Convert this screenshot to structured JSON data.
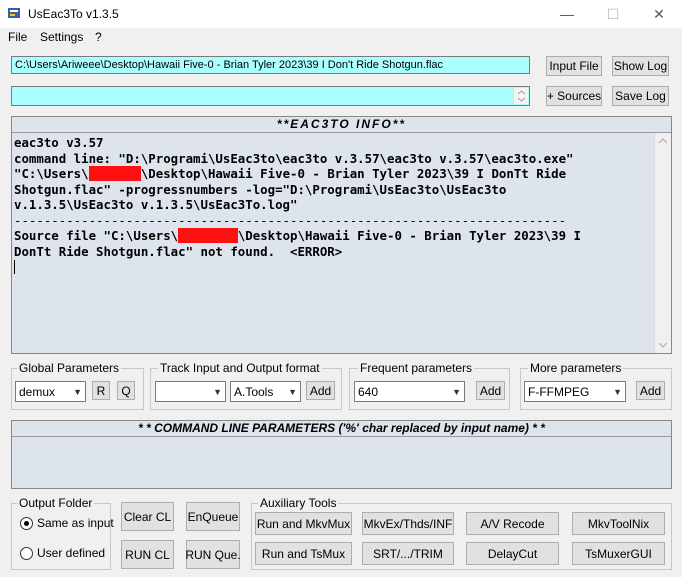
{
  "window": {
    "title": "UsEac3To v1.3.5",
    "minimize": "—",
    "maximize": "☐",
    "close": "✕"
  },
  "menu": {
    "file": "File",
    "settings": "Settings",
    "help": "?"
  },
  "top": {
    "input_path": "C:\\Users\\Ariweee\\Desktop\\Hawaii Five-0 - Brian Tyler 2023\\39 I Don't Ride Shotgun.flac",
    "sources_value": "",
    "input_file_btn": "Input File",
    "show_log_btn": "Show Log",
    "sources_btn": "+ Sources",
    "save_log_btn": "Save Log"
  },
  "info": {
    "header": "**EAC3TO INFO**",
    "line1": "eac3to v3.57",
    "line2": "command line: \"D:\\Programi\\UsEac3to\\eac3to v.3.57\\eac3to v.3.57\\eac3to.exe\"",
    "line3a": "\"C:\\Users\\",
    "line3_redacted": "XXXXXXX",
    "line3b": "\\Desktop\\Hawaii Five-0 - Brian Tyler 2023\\39 I DonTt Ride",
    "line4": "Shotgun.flac\" -progressnumbers -log=\"D:\\Programi\\UsEac3to\\UsEac3to",
    "line5": "v.1.3.5\\UsEac3to v.1.3.5\\UsEac3To.log\"",
    "separator": "--------------------------------------------------------------------------",
    "line6a": "Source file \"C:\\Users\\",
    "line6_redacted": "XXXXXXXX",
    "line6b": "\\Desktop\\Hawaii Five-0 - Brian Tyler 2023\\39 I",
    "line7": "DonTt Ride Shotgun.flac\" not found.  <ERROR>"
  },
  "global_params": {
    "label": "Global Parameters",
    "combo_value": "demux",
    "r_btn": "R",
    "q_btn": "Q"
  },
  "track": {
    "label": "Track Input and Output format",
    "combo1_value": "",
    "combo2_value": "A.Tools",
    "add_btn": "Add"
  },
  "frequent": {
    "label": "Frequent parameters",
    "combo_value": "640",
    "add_btn": "Add"
  },
  "more": {
    "label": "More parameters",
    "combo_value": "F-FFMPEG",
    "add_btn": "Add"
  },
  "cmd": {
    "header": "* * COMMAND LINE PARAMETERS ('%' char replaced by input name) * *",
    "value": ""
  },
  "output_folder": {
    "label": "Output Folder",
    "same_as_input": "Same as input",
    "user_defined": "User defined",
    "selected": "same_as_input"
  },
  "actions": {
    "clear_cl": "Clear CL",
    "enqueue": "EnQueue",
    "run_cl": "RUN CL",
    "run_que": "RUN Que."
  },
  "aux": {
    "label": "Auxiliary Tools",
    "run_mkvmux": "Run and MkvMux",
    "mkvex": "MkvEx/Thds/INF",
    "av_recode": "A/V Recode",
    "mkvtoolnix": "MkvToolNix",
    "run_tsmux": "Run and TsMux",
    "srt_trim": "SRT/.../TRIM",
    "delaycut": "DelayCut",
    "tsmuxergui": "TsMuxerGUI"
  }
}
